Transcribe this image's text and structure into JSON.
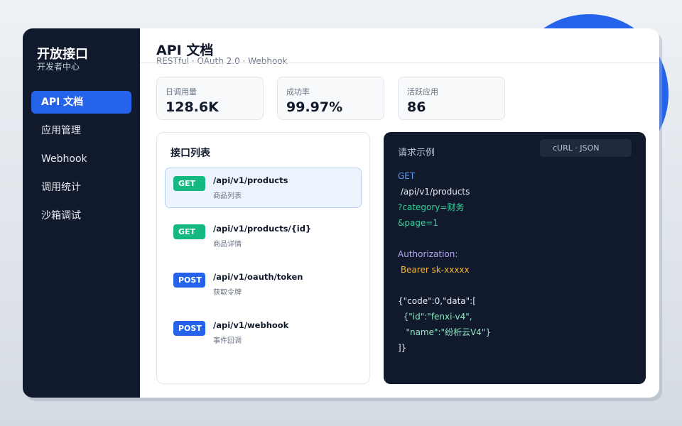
{
  "sidebar": {
    "title": "开放接口",
    "subtitle": "开发者中心",
    "items": [
      {
        "label": "API 文档",
        "active": true
      },
      {
        "label": "应用管理",
        "active": false
      },
      {
        "label": "Webhook",
        "active": false
      },
      {
        "label": "调用统计",
        "active": false
      },
      {
        "label": "沙箱调试",
        "active": false
      }
    ]
  },
  "header": {
    "title": "API 文档",
    "subtitle": "RESTful · OAuth 2.0 · Webhook"
  },
  "stats": [
    {
      "label": "日调用量",
      "value": "128.6K"
    },
    {
      "label": "成功率",
      "value": "99.97%"
    },
    {
      "label": "活跃应用",
      "value": "86"
    }
  ],
  "api_list": {
    "title": "接口列表",
    "items": [
      {
        "method": "GET",
        "path": "/api/v1/products",
        "desc": "商品列表",
        "selected": true
      },
      {
        "method": "GET",
        "path": "/api/v1/products/{id}",
        "desc": "商品详情",
        "selected": false
      },
      {
        "method": "POST",
        "path": "/api/v1/oauth/token",
        "desc": "获取令牌",
        "selected": false
      },
      {
        "method": "POST",
        "path": "/api/v1/webhook",
        "desc": "事件回调",
        "selected": false
      }
    ]
  },
  "request_example": {
    "title": "请求示例",
    "tag": "cURL · JSON",
    "lines": [
      "GET",
      " /api/v1/products",
      "?category=财务",
      "&page=1",
      "",
      "Authorization:",
      " Bearer sk-xxxxx",
      "",
      "{\"code\":0,\"data\":[",
      "  {\"id\":\"fenxi-v4\",",
      "   \"name\":\"纷析云V4\"}",
      "]}"
    ]
  },
  "colors": {
    "accent": "#2563eb",
    "sidebar_bg": "#111a2c",
    "get_badge": "#13b981",
    "post_badge": "#2563eb"
  }
}
